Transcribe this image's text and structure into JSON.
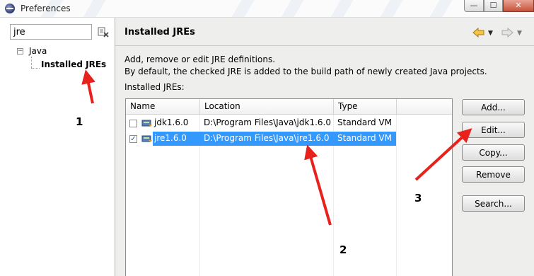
{
  "window": {
    "title": "Preferences",
    "min_symbol": "—",
    "max_symbol": "☐",
    "close_symbol": "✕",
    "app_icon": "eclipse-icon"
  },
  "sidebar": {
    "filter_value": "jre",
    "clear_icon": "clear-filter-icon",
    "tree": [
      {
        "label": "Java",
        "expanded": true
      },
      {
        "label": "Installed JREs",
        "selected": true
      }
    ],
    "expander_symbol": "−"
  },
  "page": {
    "title": "Installed JREs",
    "description_line1": "Add, remove or edit JRE definitions.",
    "description_line2": "By default, the checked JRE is added to the build path of newly created Java projects.",
    "table_label": "Installed JREs:",
    "nav": {
      "back_icon": "back-arrow-icon",
      "forward_icon": "forward-arrow-icon",
      "menu_symbol": "▼"
    }
  },
  "table": {
    "columns": [
      "Name",
      "Location",
      "Type"
    ],
    "rows": [
      {
        "checked": false,
        "name": "jdk1.6.0",
        "location": "D:\\Program Files\\Java\\jdk1.6.0",
        "type": "Standard VM",
        "selected": false,
        "check_symbol": ""
      },
      {
        "checked": true,
        "name": "jre1.6.0",
        "location": "D:\\Program Files\\Java\\jre1.6.0",
        "type": "Standard VM",
        "selected": true,
        "check_symbol": "✓"
      }
    ]
  },
  "buttons": {
    "add": "Add...",
    "edit": "Edit...",
    "copy": "Copy...",
    "remove": "Remove",
    "search": "Search..."
  },
  "annotations": {
    "one": "1",
    "two": "2",
    "three": "3",
    "arrow_color": "#e8211c"
  },
  "colors": {
    "selection": "#3399ff",
    "window_bg": "#eeeeec"
  }
}
